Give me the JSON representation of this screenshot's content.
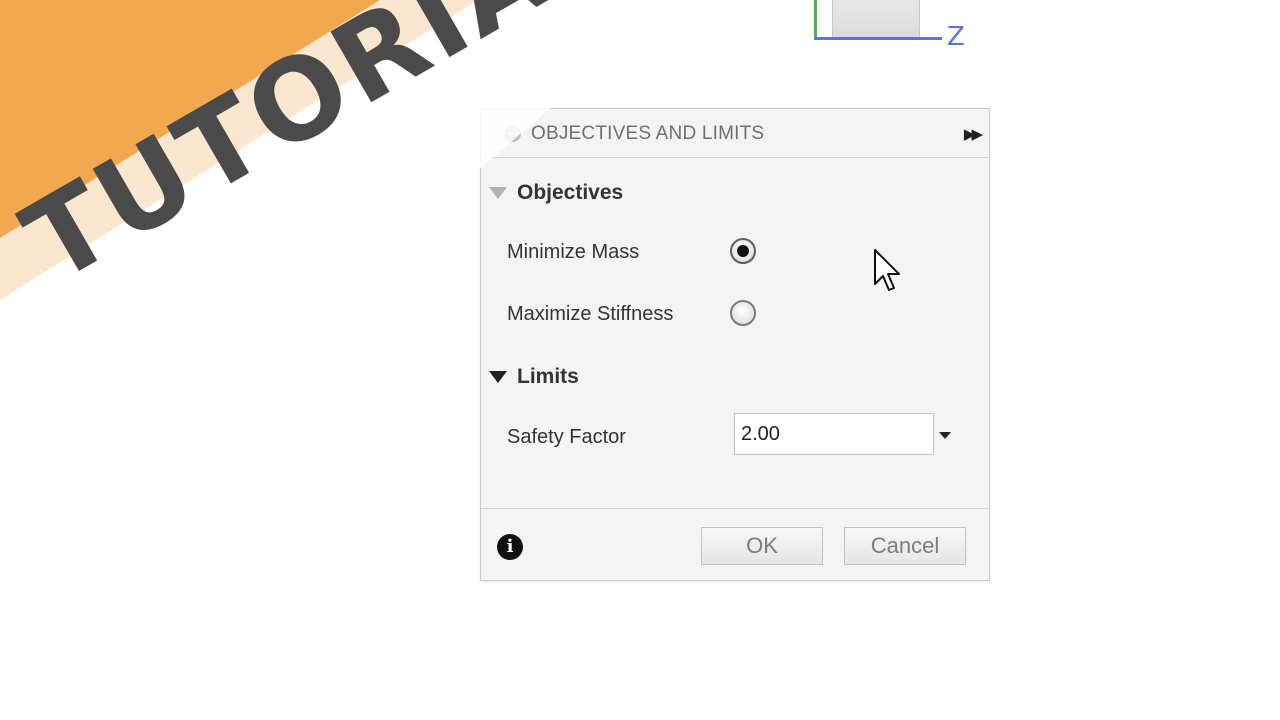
{
  "banner": {
    "text": "TUTORIAL",
    "colors": {
      "stripe": "#f2a84e",
      "band": "#fbe6cf",
      "text": "#4a4a4a"
    }
  },
  "axis": {
    "z_label": "Z"
  },
  "dialog": {
    "title": "OBJECTIVES AND LIMITS",
    "expand_icon": "double-chevron-right-icon",
    "objectives": {
      "label": "Objectives",
      "options": [
        {
          "label": "Minimize Mass",
          "selected": true
        },
        {
          "label": "Maximize Stiffness",
          "selected": false
        }
      ]
    },
    "limits": {
      "label": "Limits",
      "safety_factor_label": "Safety Factor",
      "safety_factor_value": "2.00"
    },
    "footer": {
      "info_icon": "info-icon",
      "ok_label": "OK",
      "cancel_label": "Cancel"
    }
  }
}
